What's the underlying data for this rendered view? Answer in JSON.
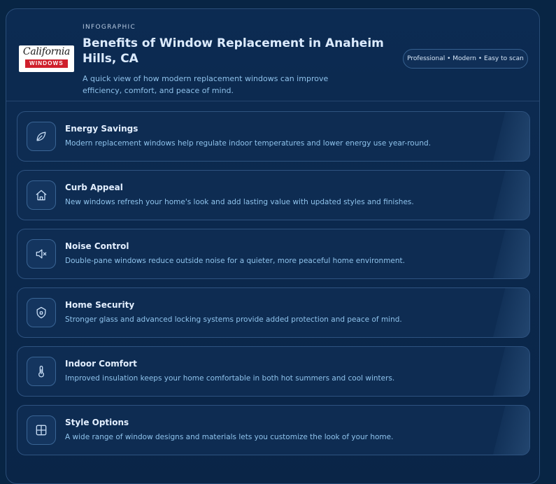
{
  "header": {
    "logo": {
      "script": "California",
      "bar": "WINDOWS"
    },
    "eyebrow": "INFOGRAPHIC",
    "title": "Benefits of Window Replacement in Anaheim Hills, CA",
    "subtitle": "A quick view of how modern replacement windows can improve efficiency, comfort, and peace of mind.",
    "badge": "Professional • Modern • Easy to scan"
  },
  "benefits": [
    {
      "icon": "leaf-icon",
      "title": "Energy Savings",
      "description": "Modern replacement windows help regulate indoor temperatures and lower energy use year-round."
    },
    {
      "icon": "home-icon",
      "title": "Curb Appeal",
      "description": "New windows refresh your home's look and add lasting value with updated styles and finishes."
    },
    {
      "icon": "speaker-muted-icon",
      "title": "Noise Control",
      "description": "Double-pane windows reduce outside noise for a quieter, more peaceful home environment."
    },
    {
      "icon": "shield-icon",
      "title": "Home Security",
      "description": "Stronger glass and advanced locking systems provide added protection and peace of mind."
    },
    {
      "icon": "thermometer-icon",
      "title": "Indoor Comfort",
      "description": "Improved insulation keeps your home comfortable in both hot summers and cool winters."
    },
    {
      "icon": "window-grid-icon",
      "title": "Style Options",
      "description": "A wide range of window designs and materials lets you customize the look of your home."
    }
  ],
  "colors": {
    "background": "#082544",
    "card": "#0c2b52",
    "border": "#2e5380",
    "title": "#dcebff",
    "accent_text": "#8fc1ea",
    "logo_red": "#cf1f2c"
  }
}
